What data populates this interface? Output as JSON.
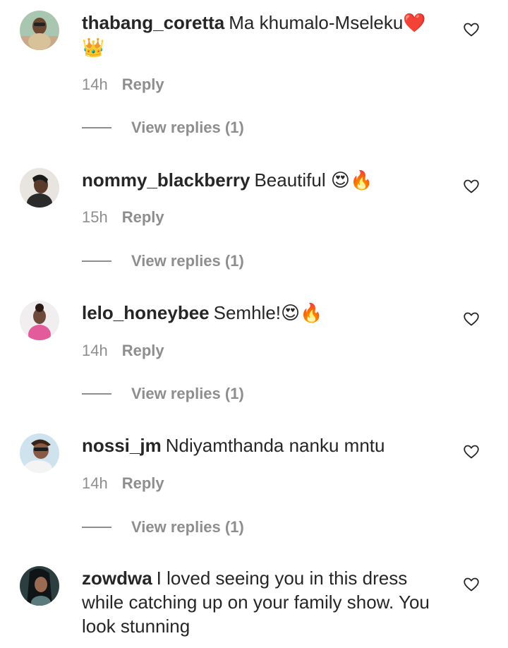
{
  "colors": {
    "text": "#262626",
    "muted": "#8e8e8e",
    "heart": "#e0245e",
    "background": "#ffffff"
  },
  "comments": [
    {
      "username": "thabang_coretta",
      "text": "Ma khumalo-Mseleku",
      "trailing_emoji": "❤️",
      "line2_emoji": "👑",
      "time": "14h",
      "reply_label": "Reply",
      "view_replies": "View replies (1)",
      "avatar": "user-photo-avatar",
      "like_icon": "heart-outline-icon"
    },
    {
      "username": "nommy_blackberry",
      "text": "Beautiful",
      "trailing_emoji": "😍🔥",
      "time": "15h",
      "reply_label": "Reply",
      "view_replies": "View replies (1)",
      "avatar": "user-photo-avatar",
      "like_icon": "heart-outline-icon"
    },
    {
      "username": "lelo_honeybee",
      "text": "Semhle!",
      "trailing_emoji": "😍🔥",
      "time": "14h",
      "reply_label": "Reply",
      "view_replies": "View replies (1)",
      "avatar": "user-photo-avatar",
      "like_icon": "heart-outline-icon"
    },
    {
      "username": "nossi_jm",
      "text": "Ndiyamthanda nanku mntu",
      "time": "14h",
      "reply_label": "Reply",
      "view_replies": "View replies (1)",
      "avatar": "user-photo-avatar",
      "like_icon": "heart-outline-icon"
    },
    {
      "username": "zowdwa",
      "text": "I loved seeing you in this dress while catching up on your family show. You look stunning",
      "avatar": "user-photo-avatar",
      "like_icon": "heart-outline-icon"
    }
  ]
}
